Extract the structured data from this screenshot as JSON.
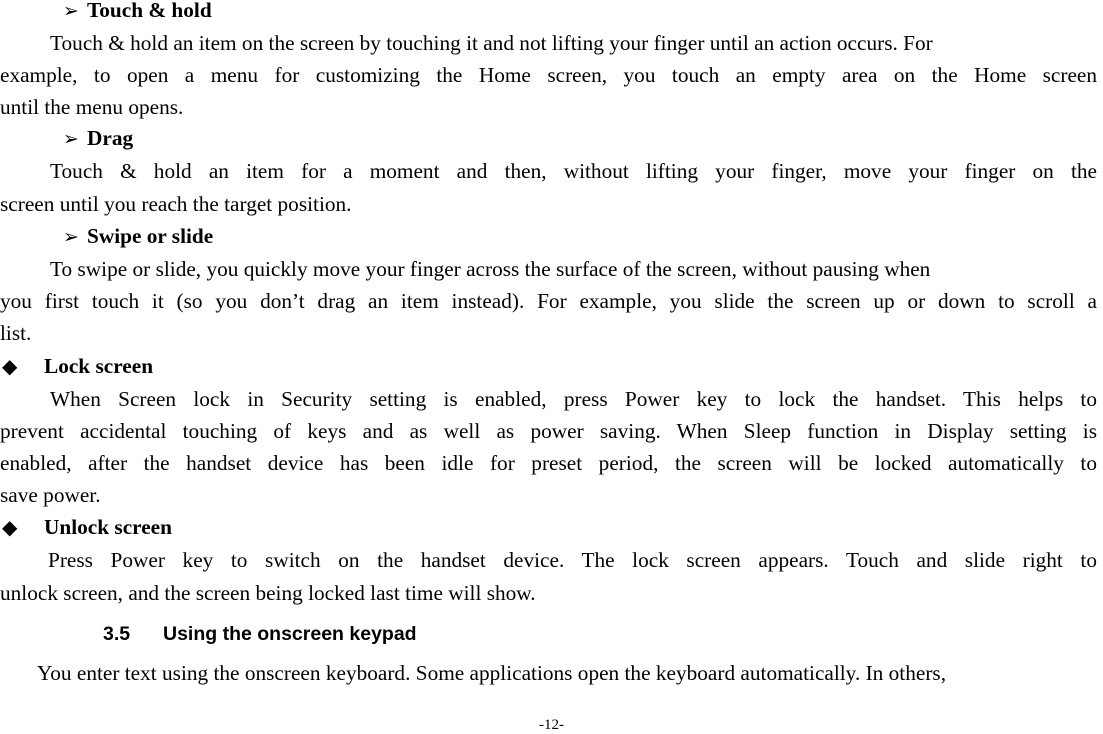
{
  "document": {
    "sections": [
      {
        "type": "sub-heading",
        "marker": "➢",
        "title": "Touch & hold",
        "paragraph_lines": [
          "Touch & hold an item on the screen by touching it and not lifting your finger until an action occurs. For",
          "example, to open a menu for customizing the Home screen, you touch an empty area on the Home screen",
          "until the menu opens."
        ]
      },
      {
        "type": "sub-heading",
        "marker": "➢",
        "title": "Drag",
        "paragraph_lines": [
          "Touch & hold an item for a moment and then, without lifting your finger, move your finger on the",
          "screen until you reach the target position."
        ]
      },
      {
        "type": "sub-heading",
        "marker": "➢",
        "title": "Swipe or slide",
        "paragraph_lines": [
          "To swipe or slide, you quickly move your finger across the surface of the screen, without pausing when",
          "you first touch it (so you don’t drag an item instead). For example, you slide the screen up or down to scroll a",
          "list."
        ]
      },
      {
        "type": "bullet-heading",
        "marker": "◆",
        "title": "Lock screen",
        "paragraph_lines": [
          "When Screen lock in Security setting is enabled, press Power key to lock the handset. This helps to",
          "prevent accidental touching of keys and as well as power saving. When Sleep function in Display setting is",
          "enabled, after the handset device has been idle for preset period, the screen will be locked automatically to",
          "save power."
        ]
      },
      {
        "type": "bullet-heading",
        "marker": "◆",
        "title": "Unlock screen",
        "paragraph_lines": [
          "Press Power key to switch on the handset device. The lock screen appears. Touch and slide right to",
          "unlock screen, and the screen being locked last time will show."
        ]
      }
    ],
    "section_heading": {
      "number": "3.5",
      "title": "Using the onscreen keypad"
    },
    "intro_line": "You enter text using the onscreen keyboard. Some applications open the keyboard automatically. In others,",
    "page_number": "-12-"
  }
}
